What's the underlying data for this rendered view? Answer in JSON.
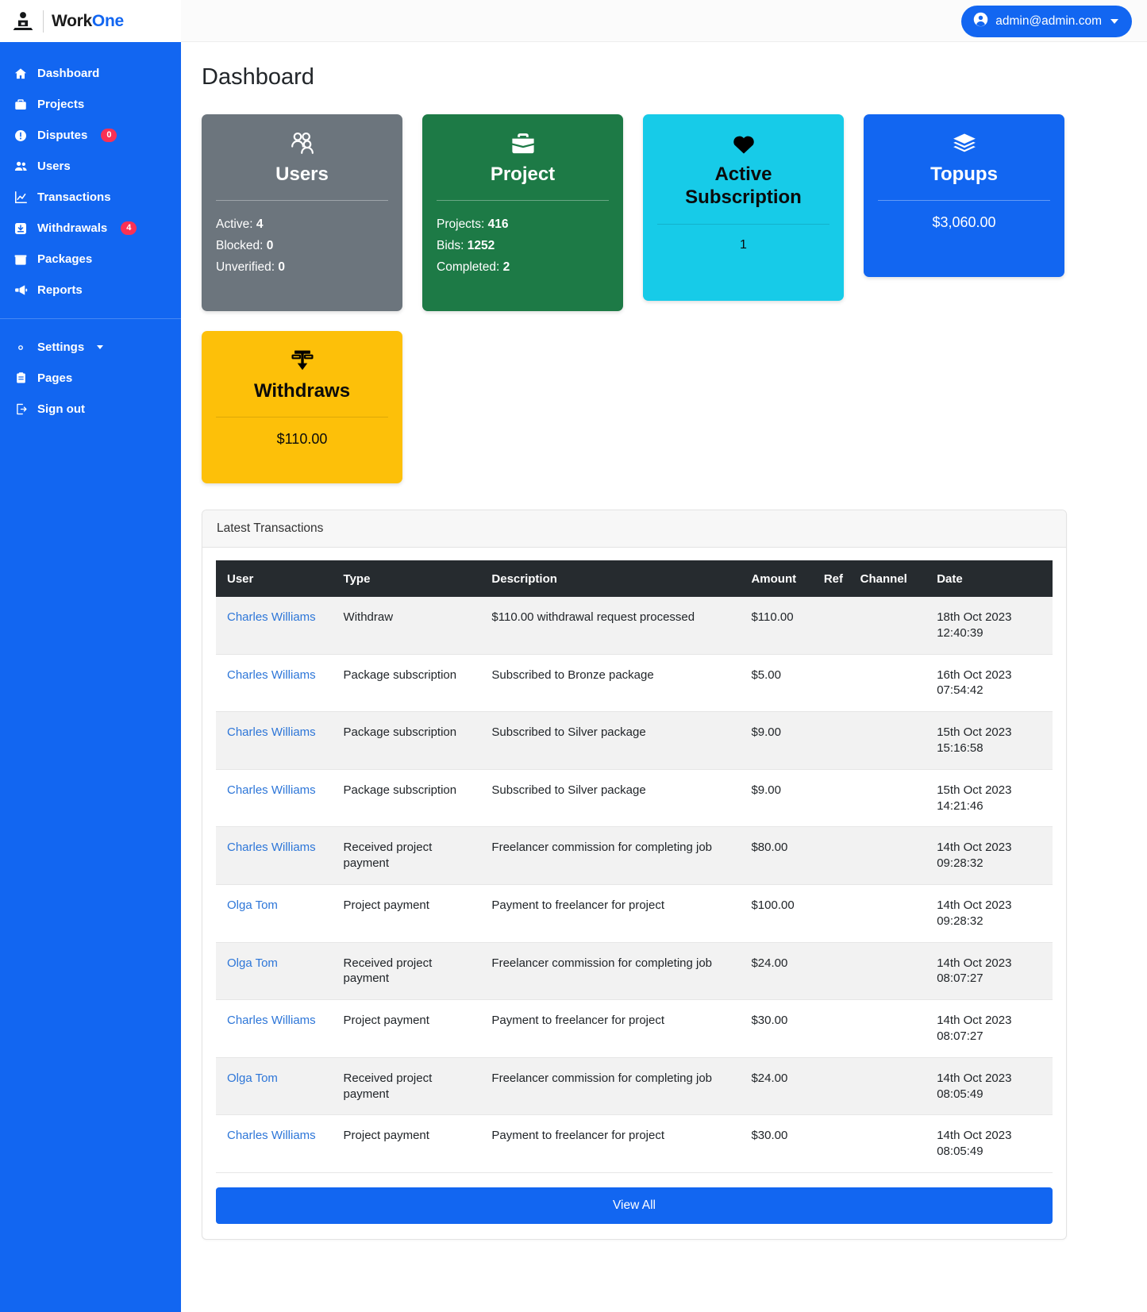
{
  "brand": {
    "name_first": "Work",
    "name_second": "One",
    "logo_icon": "person-laptop-icon"
  },
  "topbar": {
    "user_email": "admin@admin.com",
    "user_icon": "user-circle-icon",
    "caret_icon": "caret-down-icon"
  },
  "sidebar": {
    "items": [
      {
        "label": "Dashboard",
        "icon": "home-icon",
        "badge": null
      },
      {
        "label": "Projects",
        "icon": "briefcase-icon",
        "badge": null
      },
      {
        "label": "Disputes",
        "icon": "alert-circle-icon",
        "badge": "0"
      },
      {
        "label": "Users",
        "icon": "users-icon",
        "badge": null
      },
      {
        "label": "Transactions",
        "icon": "chart-line-icon",
        "badge": null
      },
      {
        "label": "Withdrawals",
        "icon": "download-box-icon",
        "badge": "4"
      },
      {
        "label": "Packages",
        "icon": "box-icon",
        "badge": null
      },
      {
        "label": "Reports",
        "icon": "megaphone-icon",
        "badge": null
      }
    ],
    "secondary_items": [
      {
        "label": "Settings",
        "icon": "gear-icon",
        "has_caret": true
      },
      {
        "label": "Pages",
        "icon": "clipboard-icon",
        "has_caret": false
      },
      {
        "label": "Sign out",
        "icon": "logout-icon",
        "has_caret": false
      }
    ]
  },
  "page": {
    "title": "Dashboard"
  },
  "cards": [
    {
      "id": "users",
      "title": "Users",
      "icon": "users-group-icon",
      "bg": "#6c757d",
      "lines": [
        {
          "label": "Active:",
          "value": "4"
        },
        {
          "label": "Blocked:",
          "value": "0"
        },
        {
          "label": "Unverified:",
          "value": "0"
        }
      ]
    },
    {
      "id": "project",
      "title": "Project",
      "icon": "briefcase-icon",
      "bg": "#1d7a46",
      "lines": [
        {
          "label": "Projects:",
          "value": "416"
        },
        {
          "label": "Bids:",
          "value": "1252"
        },
        {
          "label": "Completed:",
          "value": "2"
        }
      ]
    },
    {
      "id": "active-subscription",
      "title": "Active Subscription",
      "icon": "heart-icon",
      "bg": "#17cbe8",
      "value": "1"
    },
    {
      "id": "topups",
      "title": "Topups",
      "icon": "layers-icon",
      "bg": "#1266f1",
      "value": "$3,060.00"
    },
    {
      "id": "withdraws",
      "title": "Withdraws",
      "icon": "withdraw-arrow-icon",
      "bg": "#fdc009",
      "value": "$110.00"
    }
  ],
  "transactions": {
    "panel_title": "Latest Transactions",
    "columns": [
      "User",
      "Type",
      "Description",
      "Amount",
      "Ref",
      "Channel",
      "Date"
    ],
    "rows": [
      {
        "user": "Charles Williams",
        "type": "Withdraw",
        "description": "$110.00 withdrawal request processed",
        "amount": "$110.00",
        "ref": "",
        "channel": "",
        "date": "18th Oct 2023",
        "time": "12:40:39"
      },
      {
        "user": "Charles Williams",
        "type": "Package subscription",
        "description": "Subscribed to Bronze package",
        "amount": "$5.00",
        "ref": "",
        "channel": "",
        "date": "16th Oct 2023",
        "time": "07:54:42"
      },
      {
        "user": "Charles Williams",
        "type": "Package subscription",
        "description": "Subscribed to Silver package",
        "amount": "$9.00",
        "ref": "",
        "channel": "",
        "date": "15th Oct 2023",
        "time": "15:16:58"
      },
      {
        "user": "Charles Williams",
        "type": "Package subscription",
        "description": "Subscribed to Silver package",
        "amount": "$9.00",
        "ref": "",
        "channel": "",
        "date": "15th Oct 2023",
        "time": "14:21:46"
      },
      {
        "user": "Charles Williams",
        "type": "Received project payment",
        "description": "Freelancer commission for completing job",
        "amount": "$80.00",
        "ref": "",
        "channel": "",
        "date": "14th Oct 2023",
        "time": "09:28:32"
      },
      {
        "user": "Olga Tom",
        "type": "Project payment",
        "description": "Payment to freelancer for project",
        "amount": "$100.00",
        "ref": "",
        "channel": "",
        "date": "14th Oct 2023",
        "time": "09:28:32"
      },
      {
        "user": "Olga Tom",
        "type": "Received project payment",
        "description": "Freelancer commission for completing job",
        "amount": "$24.00",
        "ref": "",
        "channel": "",
        "date": "14th Oct 2023",
        "time": "08:07:27"
      },
      {
        "user": "Charles Williams",
        "type": "Project payment",
        "description": "Payment to freelancer for project",
        "amount": "$30.00",
        "ref": "",
        "channel": "",
        "date": "14th Oct 2023",
        "time": "08:07:27"
      },
      {
        "user": "Olga Tom",
        "type": "Received project payment",
        "description": "Freelancer commission for completing job",
        "amount": "$24.00",
        "ref": "",
        "channel": "",
        "date": "14th Oct 2023",
        "time": "08:05:49"
      },
      {
        "user": "Charles Williams",
        "type": "Project payment",
        "description": "Payment to freelancer for project",
        "amount": "$30.00",
        "ref": "",
        "channel": "",
        "date": "14th Oct 2023",
        "time": "08:05:49"
      }
    ],
    "view_all_label": "View All"
  },
  "colors": {
    "brand_blue": "#1266f1",
    "badge_red": "#f93154",
    "link_blue": "#2d76d8",
    "table_header": "#262b2f"
  }
}
